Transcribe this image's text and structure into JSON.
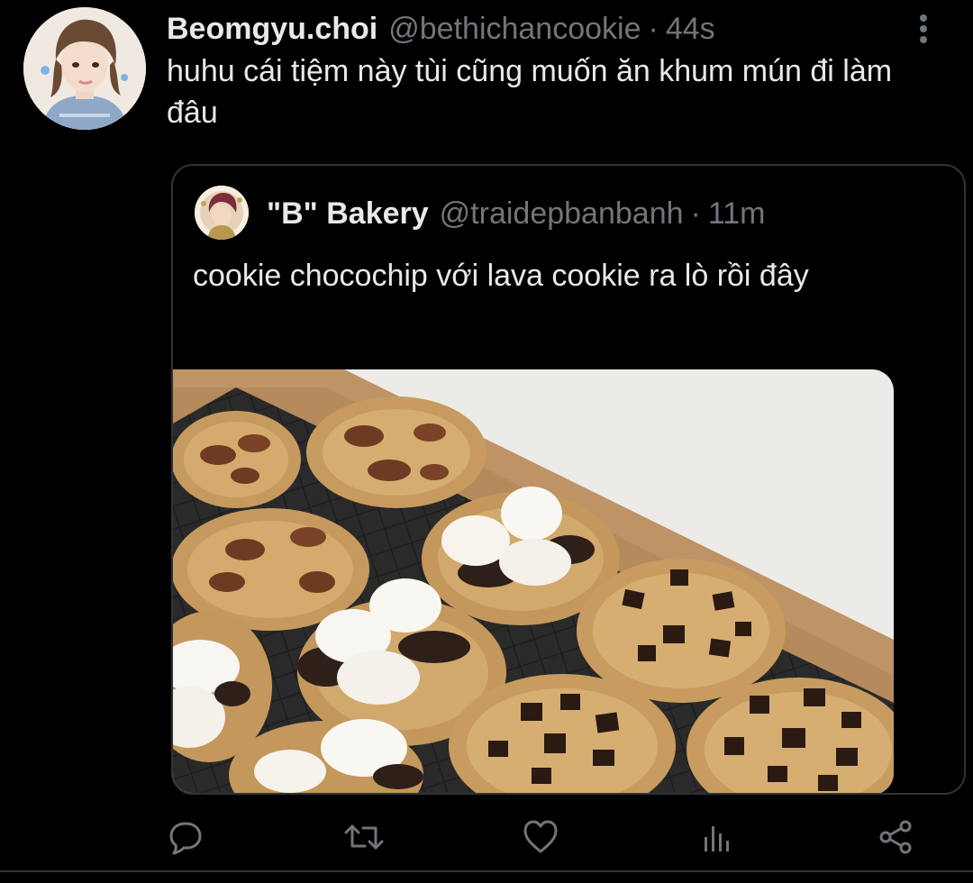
{
  "tweet": {
    "display_name": "Beomgyu.choi",
    "handle": "@bethichancookie",
    "separator": "·",
    "time": "44s",
    "text": "huhu cái tiệm này tùi cũng muốn ăn khum mún đi làm đâu"
  },
  "quoted_tweet": {
    "display_name": "\"B\" Bakery",
    "handle": "@traidepbanbanh",
    "separator": "·",
    "time": "11m",
    "text": "cookie chocochip với lava cookie ra lò rồi đây"
  },
  "actions": {
    "icons": [
      "reply-icon",
      "retweet-icon",
      "like-icon",
      "analytics-icon",
      "share-icon"
    ]
  },
  "colors": {
    "background": "#000000",
    "text_primary": "#e7e9ea",
    "text_secondary": "#71767b",
    "border": "#2f3336"
  }
}
